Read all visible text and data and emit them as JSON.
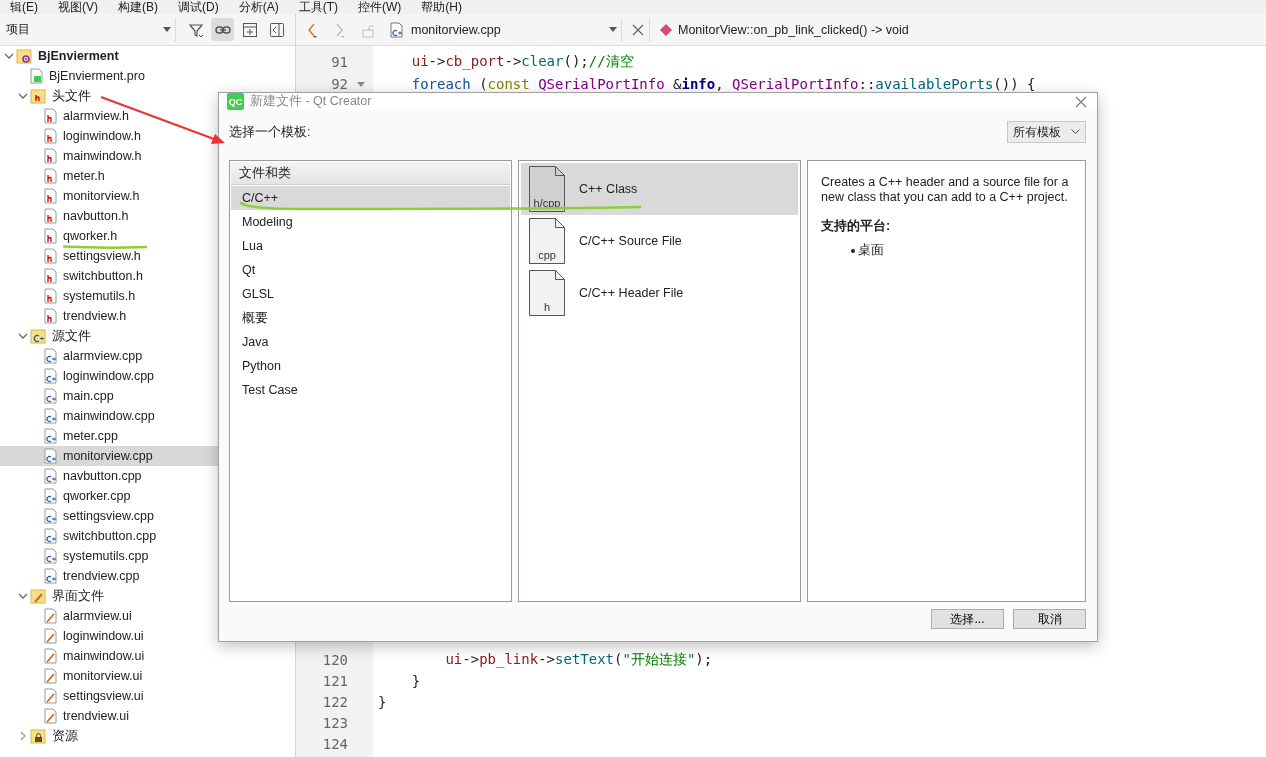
{
  "menu_bar": [
    "辑(E)",
    "视图(V)",
    "构建(B)",
    "调试(D)",
    "分析(A)",
    "工具(T)",
    "控件(W)",
    "帮助(H)"
  ],
  "project_panel": {
    "selector": "项目",
    "tools": [
      {
        "kind": "filter",
        "selected": false
      },
      {
        "kind": "link",
        "selected": true
      },
      {
        "kind": "split",
        "selected": false
      },
      {
        "kind": "close",
        "selected": false
      }
    ]
  },
  "tree": [
    {
      "label": "BjEnvierment",
      "kind": "project",
      "expanded": true,
      "selected": false,
      "children": [
        {
          "label": "BjEnvierment.pro",
          "kind": "pro",
          "selected": false
        },
        {
          "label": "头文件",
          "kind": "folder-h",
          "expanded": true,
          "selected": false,
          "children": [
            {
              "label": "alarmview.h",
              "kind": "header",
              "selected": false
            },
            {
              "label": "loginwindow.h",
              "kind": "header",
              "selected": false
            },
            {
              "label": "mainwindow.h",
              "kind": "header",
              "selected": false
            },
            {
              "label": "meter.h",
              "kind": "header",
              "selected": false
            },
            {
              "label": "monitorview.h",
              "kind": "header",
              "selected": false
            },
            {
              "label": "navbutton.h",
              "kind": "header",
              "selected": false
            },
            {
              "label": "qworker.h",
              "kind": "header",
              "selected": false
            },
            {
              "label": "settingsview.h",
              "kind": "header",
              "selected": false
            },
            {
              "label": "switchbutton.h",
              "kind": "header",
              "selected": false
            },
            {
              "label": "systemutils.h",
              "kind": "header",
              "selected": false
            },
            {
              "label": "trendview.h",
              "kind": "header",
              "selected": false
            }
          ]
        },
        {
          "label": "源文件",
          "kind": "folder-cpp",
          "expanded": true,
          "selected": false,
          "children": [
            {
              "label": "alarmview.cpp",
              "kind": "source",
              "selected": false
            },
            {
              "label": "loginwindow.cpp",
              "kind": "source",
              "selected": false
            },
            {
              "label": "main.cpp",
              "kind": "source",
              "selected": false
            },
            {
              "label": "mainwindow.cpp",
              "kind": "source",
              "selected": false
            },
            {
              "label": "meter.cpp",
              "kind": "source",
              "selected": false
            },
            {
              "label": "monitorview.cpp",
              "kind": "source",
              "selected": true
            },
            {
              "label": "navbutton.cpp",
              "kind": "source",
              "selected": false
            },
            {
              "label": "qworker.cpp",
              "kind": "source",
              "selected": false
            },
            {
              "label": "settingsview.cpp",
              "kind": "source",
              "selected": false
            },
            {
              "label": "switchbutton.cpp",
              "kind": "source",
              "selected": false
            },
            {
              "label": "systemutils.cpp",
              "kind": "source",
              "selected": false
            },
            {
              "label": "trendview.cpp",
              "kind": "source",
              "selected": false
            }
          ]
        },
        {
          "label": "界面文件",
          "kind": "folder-ui",
          "expanded": true,
          "selected": false,
          "children": [
            {
              "label": "alarmview.ui",
              "kind": "form",
              "selected": false
            },
            {
              "label": "loginwindow.ui",
              "kind": "form",
              "selected": false
            },
            {
              "label": "mainwindow.ui",
              "kind": "form",
              "selected": false
            },
            {
              "label": "monitorview.ui",
              "kind": "form",
              "selected": false
            },
            {
              "label": "settingsview.ui",
              "kind": "form",
              "selected": false
            },
            {
              "label": "trendview.ui",
              "kind": "form",
              "selected": false
            }
          ]
        },
        {
          "label": "资源",
          "kind": "folder-res",
          "expanded": false,
          "selected": false
        }
      ]
    }
  ],
  "editor": {
    "back_enabled": true,
    "forward_enabled": false,
    "file": "monitorview.cpp",
    "symbol": "MonitorView::on_pb_link_clicked() -> void",
    "top_lines": [
      {
        "number": "91",
        "foldable": false,
        "tokens": [
          {
            "kind": "var",
            "text": "    ui"
          },
          {
            "kind": "plain",
            "text": "->"
          },
          {
            "kind": "var",
            "text": "cb_port"
          },
          {
            "kind": "plain",
            "text": "->"
          },
          {
            "kind": "func",
            "text": "clear"
          },
          {
            "kind": "plain",
            "text": "();"
          },
          {
            "kind": "comment",
            "text": "//清空"
          }
        ]
      },
      {
        "number": "92",
        "foldable": true,
        "tokens": [
          {
            "kind": "keyword",
            "text": "    foreach"
          },
          {
            "kind": "plain",
            "text": " ("
          },
          {
            "kind": "const",
            "text": "const"
          },
          {
            "kind": "type",
            "text": " QSerialPortInfo"
          },
          {
            "kind": "plain",
            "text": " &"
          },
          {
            "kind": "param",
            "text": "info"
          },
          {
            "kind": "plain",
            "text": ", "
          },
          {
            "kind": "type",
            "text": "QSerialPortInfo"
          },
          {
            "kind": "plain",
            "text": "::"
          },
          {
            "kind": "func",
            "text": "availablePorts"
          },
          {
            "kind": "plain",
            "text": "()) {"
          }
        ]
      }
    ],
    "bottom_lines": [
      {
        "number": "120",
        "foldable": false,
        "tokens": [
          {
            "kind": "var",
            "text": "        ui"
          },
          {
            "kind": "plain",
            "text": "->"
          },
          {
            "kind": "var",
            "text": "pb_link"
          },
          {
            "kind": "plain",
            "text": "->"
          },
          {
            "kind": "func",
            "text": "setText"
          },
          {
            "kind": "plain",
            "text": "("
          },
          {
            "kind": "string",
            "text": "\"开始连接\""
          },
          {
            "kind": "plain",
            "text": ");"
          }
        ]
      },
      {
        "number": "121",
        "foldable": false,
        "tokens": [
          {
            "kind": "plain",
            "text": "    }"
          }
        ]
      },
      {
        "number": "122",
        "foldable": false,
        "tokens": [
          {
            "kind": "plain",
            "text": "}"
          }
        ]
      },
      {
        "number": "123",
        "foldable": false
      },
      {
        "number": "124",
        "foldable": false
      }
    ]
  },
  "dialog": {
    "logo": "QC",
    "title": "新建文件 - Qt Creator",
    "prompt": "选择一个模板:",
    "filter": "所有模板",
    "categories_header": "文件和类",
    "categories": [
      {
        "label": "C/C++",
        "selected": true
      },
      {
        "label": "Modeling",
        "selected": false
      },
      {
        "label": "Lua",
        "selected": false
      },
      {
        "label": "Qt",
        "selected": false
      },
      {
        "label": "GLSL",
        "selected": false
      },
      {
        "label": "概要",
        "selected": false
      },
      {
        "label": "Java",
        "selected": false
      },
      {
        "label": "Python",
        "selected": false
      },
      {
        "label": "Test Case",
        "selected": false
      }
    ],
    "templates": [
      {
        "label": "C++ Class",
        "icon_label": "h/cpp",
        "selected": true
      },
      {
        "label": "C/C++ Source File",
        "icon_label": "cpp",
        "selected": false
      },
      {
        "label": "C/C++ Header File",
        "icon_label": "h",
        "selected": false
      }
    ],
    "description": "Creates a C++ header and a source file for a new class that you can add to a C++ project.",
    "platforms_label": "支持的平台:",
    "platforms": [
      "桌面"
    ],
    "buttons": [
      "选择...",
      "取消"
    ]
  }
}
